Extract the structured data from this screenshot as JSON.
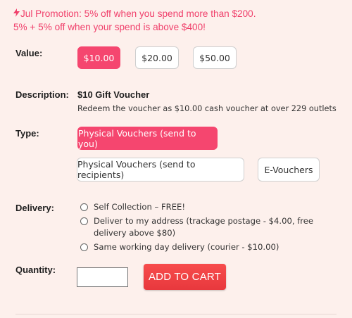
{
  "promo": {
    "line1": "Jul Promotion: 5% off when you spend more than $200.",
    "line2": "5% + 5% off when your spend is above $400!",
    "icon": "lightning-bolt-icon",
    "color": "#f0406b"
  },
  "value": {
    "label": "Value:",
    "options": [
      "$10.00",
      "$20.00",
      "$50.00"
    ],
    "selected": "$10.00"
  },
  "description": {
    "label": "Description:",
    "title": "$10 Gift Voucher",
    "text": "Redeem the voucher as $10.00 cash voucher at over 229 outlets"
  },
  "type": {
    "label": "Type:",
    "options": [
      "Physical Vouchers (send to you)",
      "Physical Vouchers (send to recipients)",
      "E-Vouchers"
    ],
    "selected": "Physical Vouchers (send to you)"
  },
  "delivery": {
    "label": "Delivery:",
    "options": [
      "Self Collection – FREE!",
      "Deliver to my address (trackage postage - $4.00, free delivery above $80)",
      "Same working day delivery (courier - $10.00)"
    ]
  },
  "quantity": {
    "label": "Quantity:",
    "value": ""
  },
  "cart": {
    "button_label": "ADD TO CART"
  },
  "colors": {
    "accent": "#f5466f",
    "cart": "#ef4040",
    "background": "#fdf0ec"
  }
}
